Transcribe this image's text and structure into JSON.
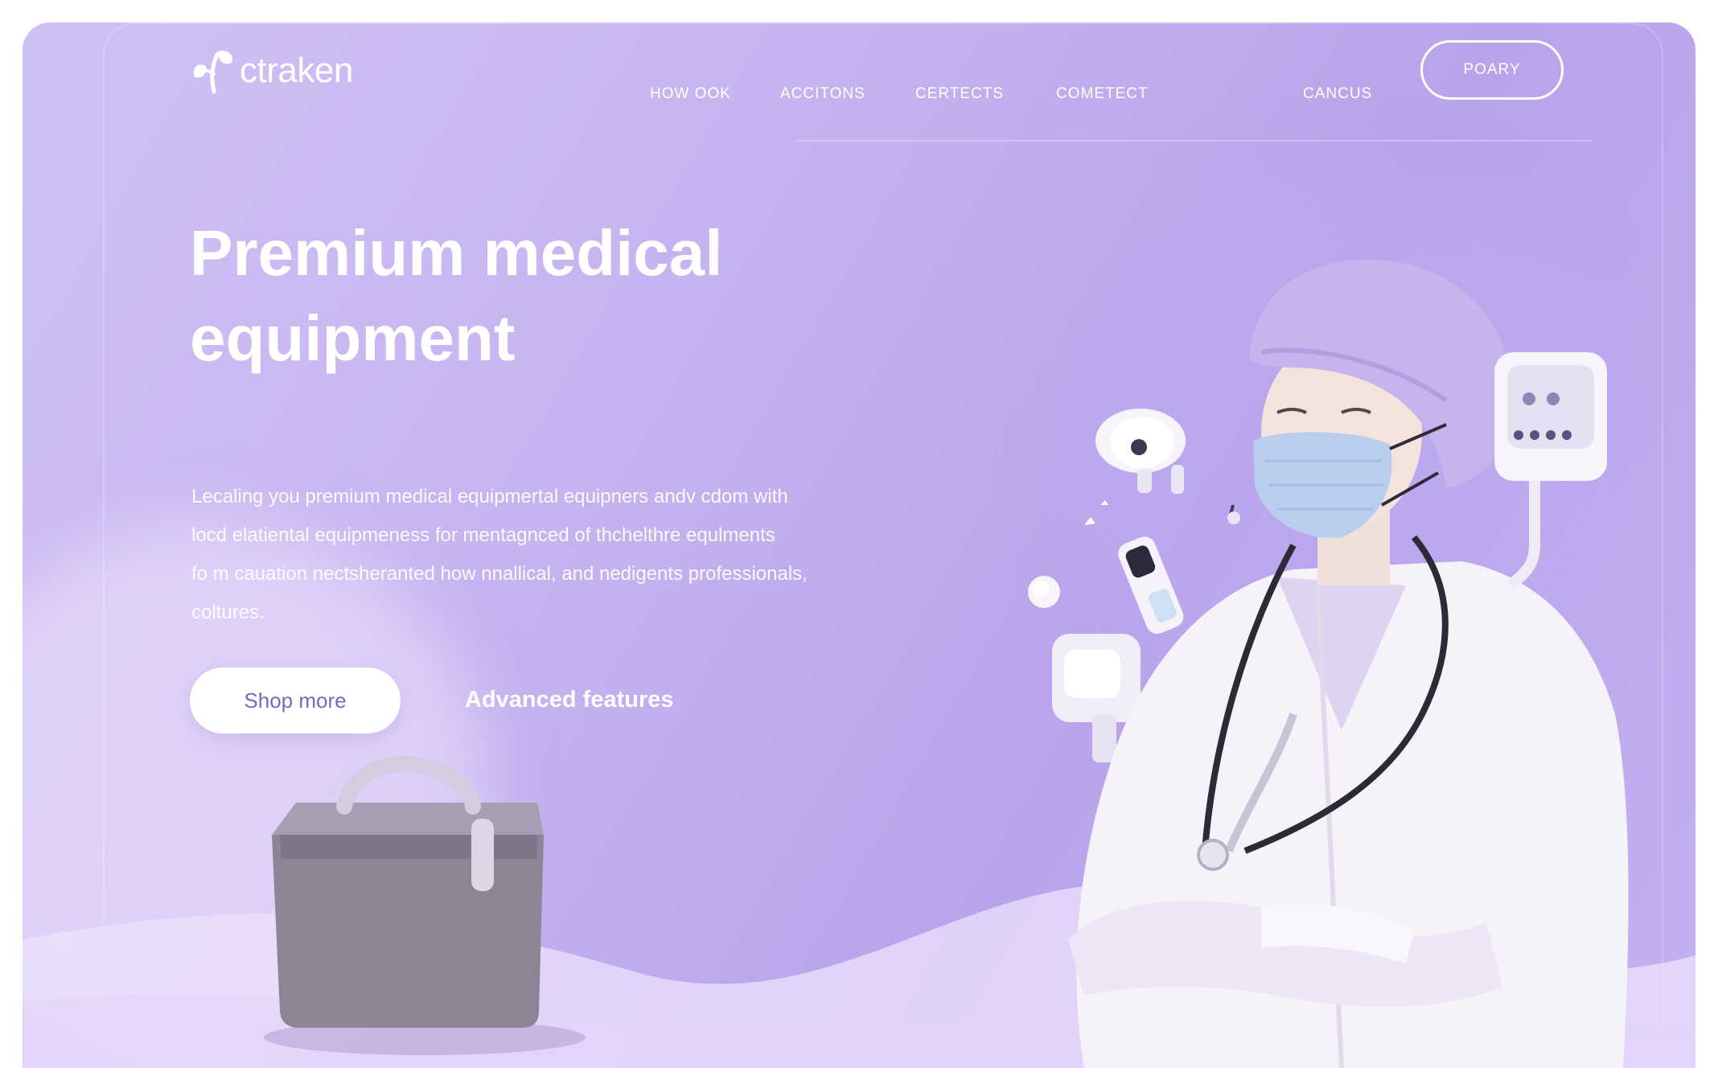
{
  "brand": {
    "name": "ctraken"
  },
  "nav": {
    "links": [
      "HOW OOK",
      "ACCITONS",
      "CERTECTS",
      "COMETECT"
    ],
    "secondary_link": "CANCUS",
    "cta_label": "POARY"
  },
  "hero": {
    "headline_line1": "Premium medical",
    "headline_line2": "equipment",
    "body_lines": [
      "Lecaling you premium medical equipmertal equipners andv cdom with",
      "locd elatiental equipmeness for mentagnced of thchelthre equlments",
      "fo m cauation nectsheranted how nnallical, and nedigents professionals,",
      "coltures."
    ],
    "primary_button": "Shop more",
    "secondary_link": "Advanced features"
  },
  "colors": {
    "background_lavender": "#c6b4f0",
    "button_text": "#7a68b8",
    "white": "#ffffff"
  },
  "images": {
    "hero_illustration": "doctor-with-stethoscope-and-floating-devices",
    "case_illustration": "medical-carry-case"
  }
}
